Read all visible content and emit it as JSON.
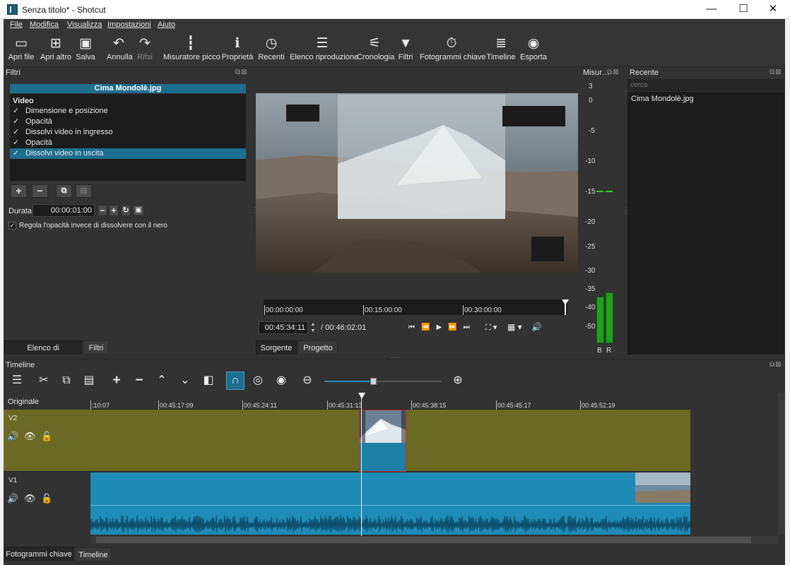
{
  "window": {
    "title": "Senza titolo* - Shotcut",
    "minimize": "—",
    "maximize": "☐",
    "close": "✕"
  },
  "menu": [
    "File",
    "Modifica",
    "Visualizza",
    "Impostazioni",
    "Aiuto"
  ],
  "toolbar": {
    "open_file": "Apri file",
    "open_other": "Apri altro",
    "save": "Salva",
    "undo": "Annulla",
    "redo": "Rifai",
    "peak_meter": "Misuratore picco",
    "properties": "Proprietà",
    "recent": "Recenti",
    "playlist": "Elenco riproduzione",
    "history": "Cronologia",
    "filters": "Filtri",
    "keyframes": "Fotogrammi chiave",
    "timeline": "Timeline",
    "export": "Esporta"
  },
  "filters_panel": {
    "title": "Filtri",
    "clip_name": "Cima Mondolè.jpg",
    "section": "Video",
    "items": [
      "Dimensione e posizione",
      "Opacità",
      "Dissolvi video in ingresso",
      "Opacità",
      "Dissolvi video in uscita"
    ],
    "selected_index": 4,
    "duration_label": "Durata",
    "duration_value": "00:00:01:00",
    "checkbox_label": "Regola l'opacità invece di dissolvere con il nero",
    "tabs": [
      "Elenco di riproduzione",
      "Filtri"
    ]
  },
  "player": {
    "ruler": [
      "00:00:00:00",
      "00:15:00:00",
      "00:30:00:00"
    ],
    "current_time": "00:45:34:11",
    "total_time": "/ 00:46:02:01",
    "tabs": [
      "Sorgente",
      "Progetto"
    ]
  },
  "meter_panel": {
    "title": "Misur…",
    "scale": [
      "3",
      "0",
      "-5",
      "-10",
      "-15",
      "-20",
      "-25",
      "-30",
      "-35",
      "-40",
      "-50"
    ],
    "channels": [
      "B",
      "R"
    ]
  },
  "recent_panel": {
    "title": "Recente",
    "search_placeholder": "cerca",
    "items": [
      "Cima Mondolè.jpg"
    ]
  },
  "timeline": {
    "title": "Timeline",
    "track_header_label": "Originale",
    "ruler": [
      ":10:07",
      "00:45:17:09",
      "00:45:24:11",
      "00:45:31:13",
      "00:45:38:15",
      "00:45:45:17",
      "00:45:52:19"
    ],
    "tracks": [
      "V2",
      "V1"
    ],
    "zoom_level": 0.42,
    "bottom_tabs": [
      "Fotogrammi chiave",
      "Timeline"
    ]
  },
  "colors": {
    "v2_track": "#6a6a24",
    "v1_clip": "#1f8bb6",
    "selection": "#1e6e8f",
    "meter_green": "#1fa01f"
  }
}
